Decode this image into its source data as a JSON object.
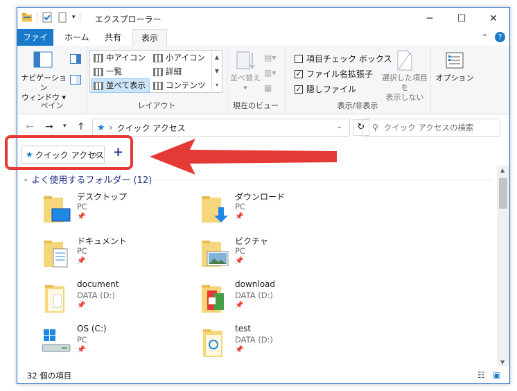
{
  "window": {
    "title": "エクスプローラー"
  },
  "menu": {
    "file": "ファイル",
    "home": "ホーム",
    "share": "共有",
    "view": "表示"
  },
  "ribbon": {
    "pane": {
      "nav_label_line1": "ナビゲーション",
      "nav_label_line2": "ウィンドウ",
      "group": "ペイン"
    },
    "layout": {
      "group": "レイアウト",
      "items": [
        "中アイコン",
        "小アイコン",
        "一覧",
        "詳細",
        "並べて表示",
        "コンテンツ"
      ]
    },
    "current_view": {
      "group": "現在のビュー",
      "sort": "並べ替え"
    },
    "show_hide": {
      "group": "表示/非表示",
      "item_checkbox": "項目チェック ボックス",
      "extensions": "ファイル名拡張子",
      "hidden": "隠しファイル",
      "hide_selected_line1": "選択した項目を",
      "hide_selected_line2": "表示しない",
      "options": "オプション"
    }
  },
  "address": {
    "path": "クイック アクセス",
    "separator": "›"
  },
  "search": {
    "placeholder": "クイック アクセスの検索"
  },
  "tabs": {
    "active": "クイック アクセス",
    "add": "+"
  },
  "content": {
    "group_header": "よく使用するフォルダー (12)",
    "items": [
      {
        "name": "デスクトップ",
        "sub": "PC"
      },
      {
        "name": "ダウンロード",
        "sub": "PC"
      },
      {
        "name": "ドキュメント",
        "sub": "PC"
      },
      {
        "name": "ピクチャ",
        "sub": "PC"
      },
      {
        "name": "document",
        "sub": "DATA (D:)"
      },
      {
        "name": "download",
        "sub": "DATA (D:)"
      },
      {
        "name": "OS (C:)",
        "sub": "PC"
      },
      {
        "name": "test",
        "sub": "DATA (D:)"
      }
    ]
  },
  "status": {
    "count": "32 個の項目"
  },
  "colors": {
    "accent": "#1979ca",
    "highlight": "#e53935"
  }
}
